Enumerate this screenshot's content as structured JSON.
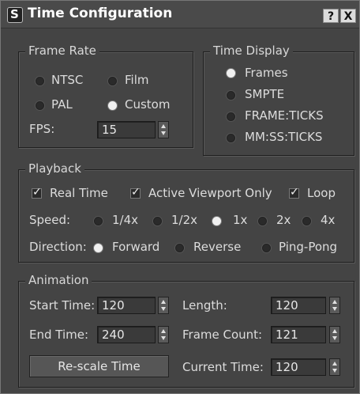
{
  "window": {
    "title": "Time Configuration",
    "help_label": "?",
    "close_label": "X"
  },
  "frame_rate": {
    "label": "Frame Rate",
    "options": [
      "NTSC",
      "Film",
      "PAL",
      "Custom"
    ],
    "selected": "Custom",
    "fps_label": "FPS:",
    "fps_value": "15"
  },
  "time_display": {
    "label": "Time Display",
    "options": [
      "Frames",
      "SMPTE",
      "FRAME:TICKS",
      "MM:SS:TICKS"
    ],
    "selected": "Frames"
  },
  "playback": {
    "label": "Playback",
    "real_time_label": "Real Time",
    "active_viewport_label": "Active Viewport Only",
    "loop_label": "Loop",
    "real_time_checked": true,
    "active_viewport_checked": true,
    "loop_checked": true,
    "speed_label": "Speed:",
    "speed_options": [
      "1/4x",
      "1/2x",
      "1x",
      "2x",
      "4x"
    ],
    "speed_selected": "1x",
    "direction_label": "Direction:",
    "direction_options": [
      "Forward",
      "Reverse",
      "Ping-Pong"
    ],
    "direction_selected": "Forward"
  },
  "animation": {
    "label": "Animation",
    "start_time_label": "Start Time:",
    "start_time_value": "120",
    "end_time_label": "End Time:",
    "end_time_value": "240",
    "length_label": "Length:",
    "length_value": "120",
    "frame_count_label": "Frame Count:",
    "frame_count_value": "121",
    "current_time_label": "Current Time:",
    "current_time_value": "120",
    "rescale_label": "Re-scale Time"
  }
}
